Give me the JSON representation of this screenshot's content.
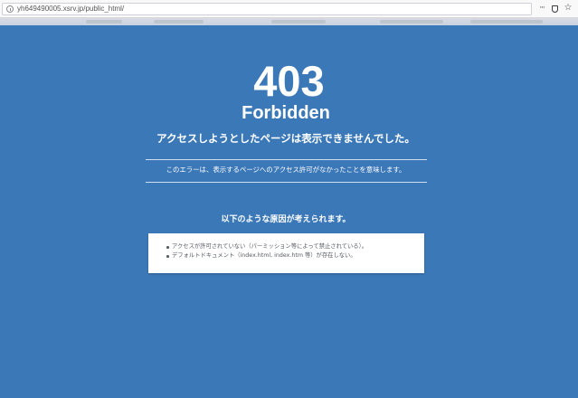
{
  "browser": {
    "url": "yh649490005.xsrv.jp/public_html/"
  },
  "error": {
    "code": "403",
    "title": "Forbidden",
    "message": "アクセスしようとしたページは表示できませんでした。",
    "detail": "このエラーは、表示するページへのアクセス許可がなかったことを意味します。"
  },
  "causes": {
    "heading": "以下のような原因が考えられます。",
    "items": [
      "アクセスが許可されていない（パーミッション等によって禁止されている）。",
      "デフォルトドキュメント（index.html, index.htm 等）が存在しない。"
    ]
  },
  "colors": {
    "page_background": "#3b78b8",
    "text": "#ffffff",
    "box_background": "#ffffff",
    "box_text": "#555b63"
  }
}
